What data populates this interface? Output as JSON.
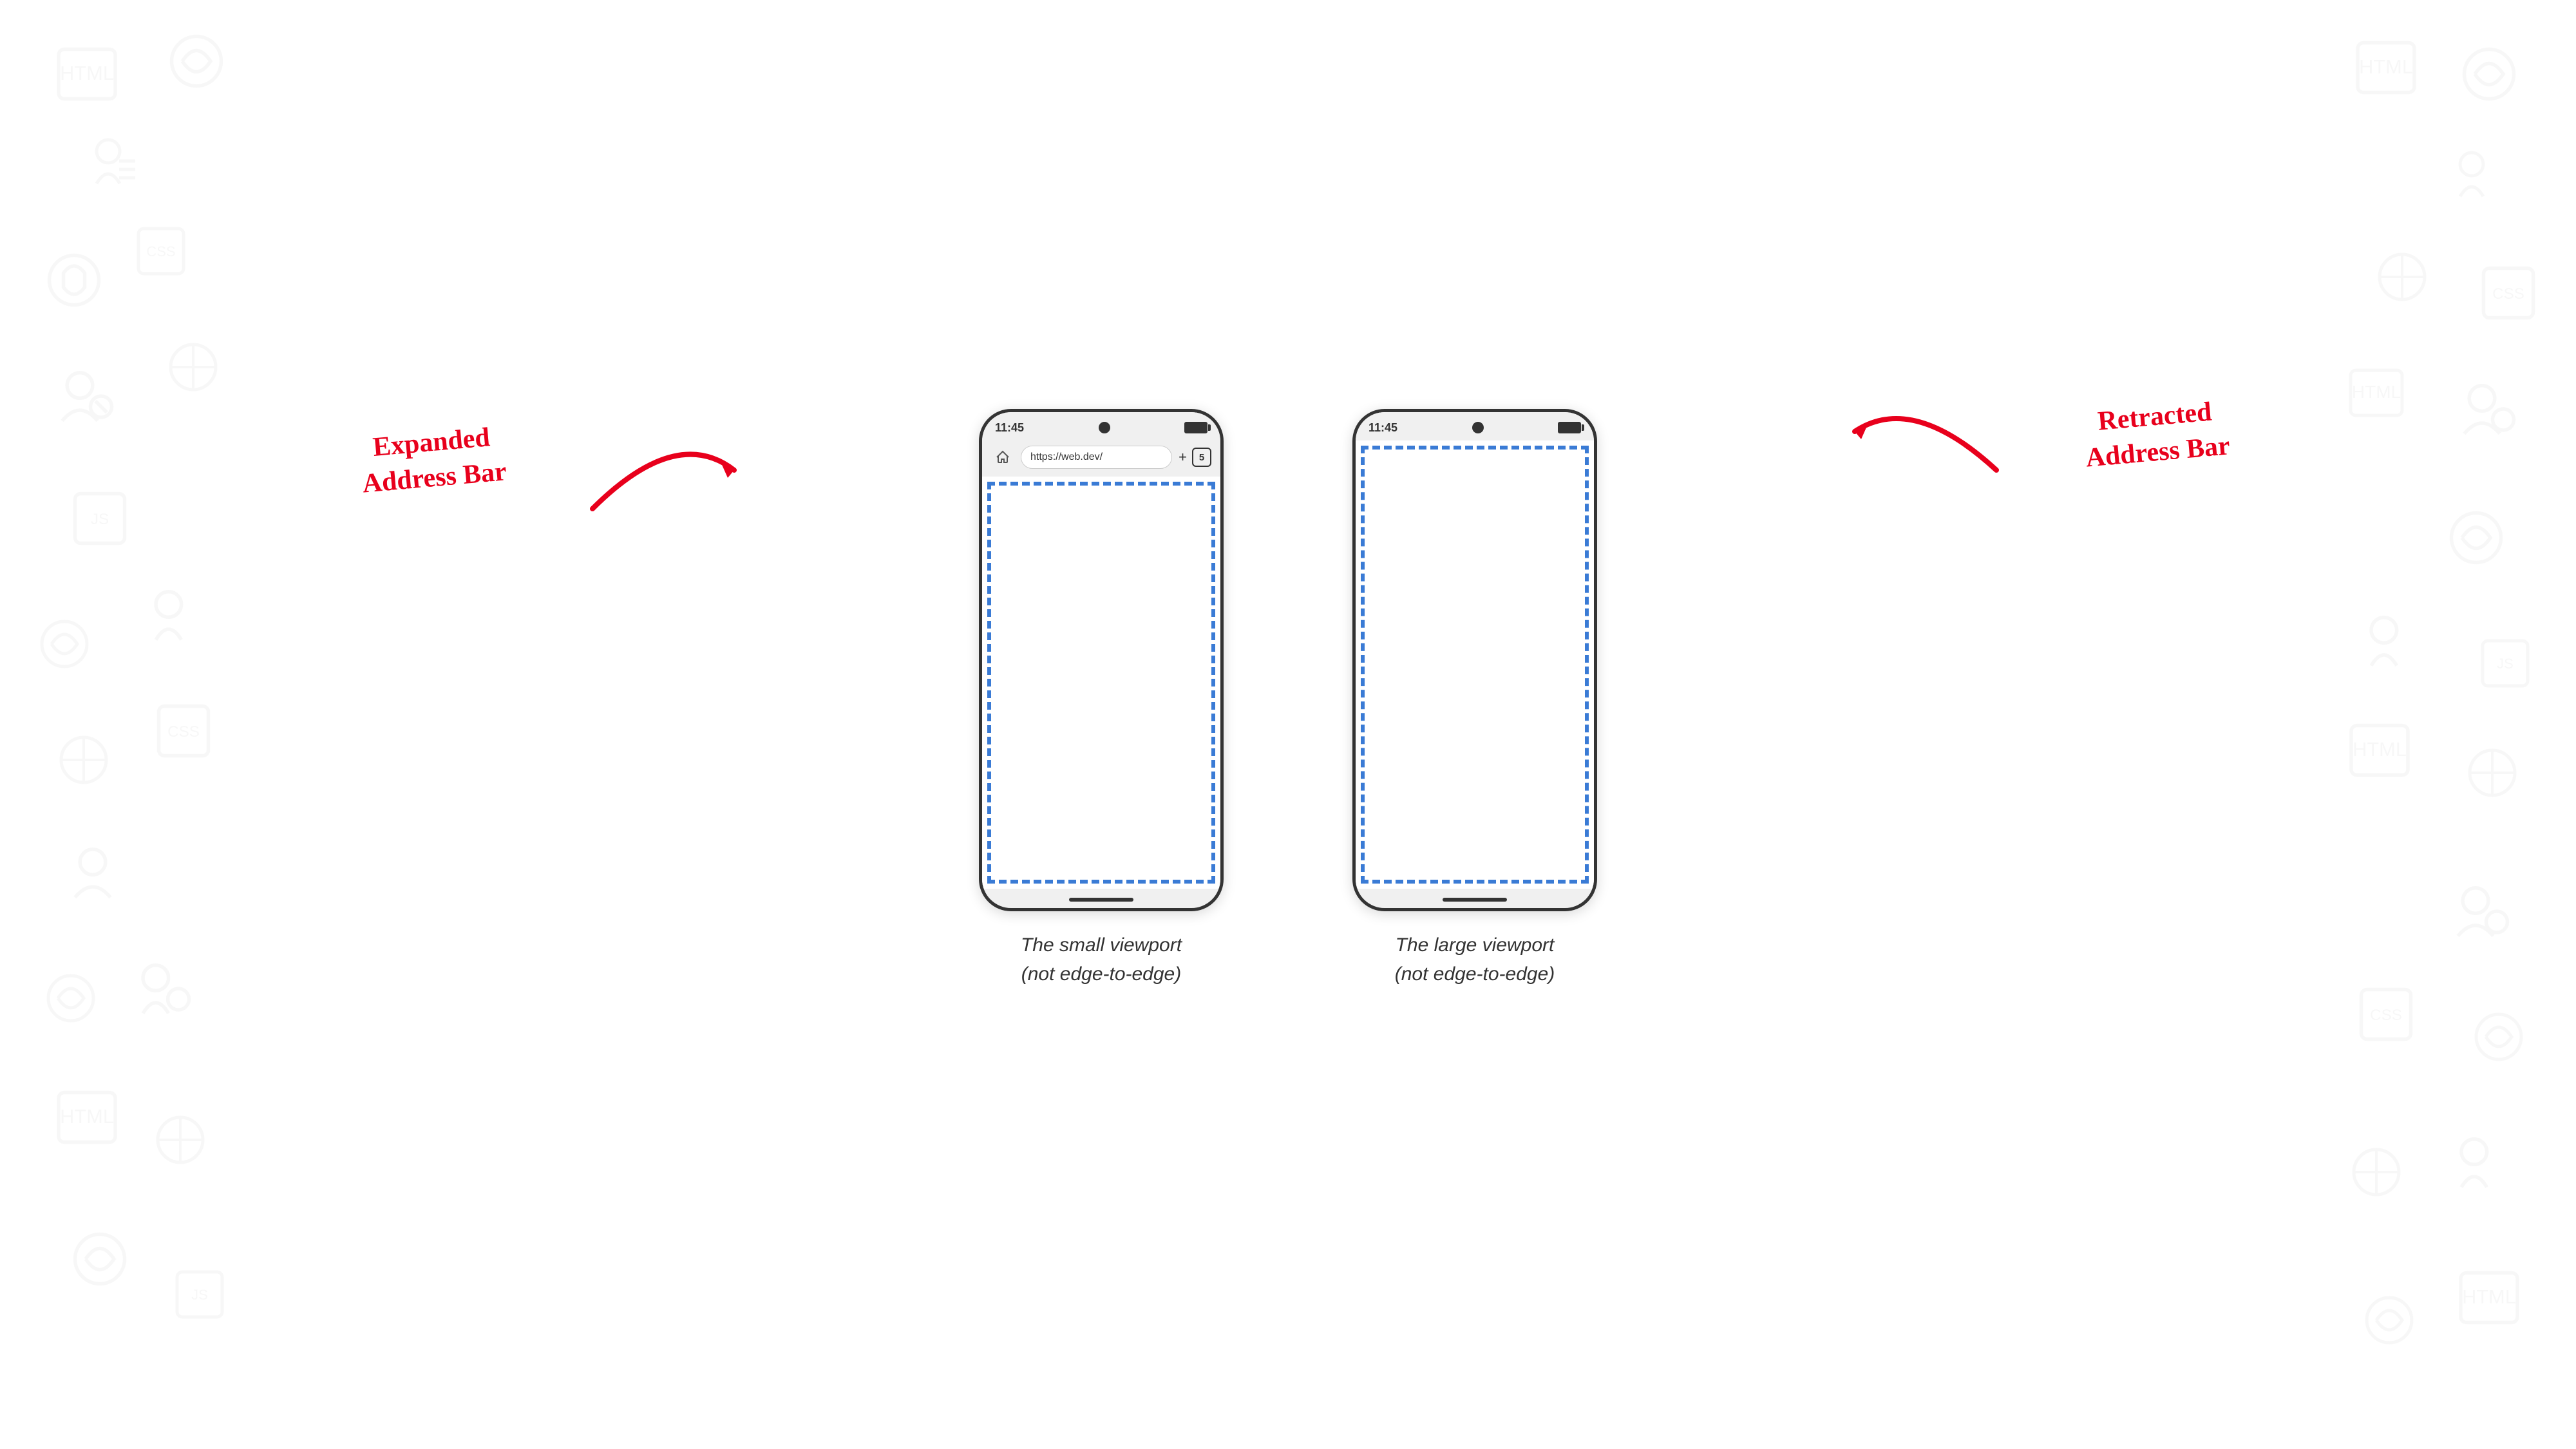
{
  "background": {
    "color": "#ffffff"
  },
  "phone_small": {
    "status_time": "11:45",
    "url": "https://web.dev/",
    "tab_count": "5",
    "label_line1": "The small viewport",
    "label_line2": "(not edge-to-edge)"
  },
  "phone_large": {
    "status_time": "11:45",
    "label_line1": "The large viewport",
    "label_line2": "(not edge-to-edge)"
  },
  "annotation_left": {
    "line1": "Expanded",
    "line2": "Address Bar"
  },
  "annotation_right": {
    "line1": "Retracted",
    "line2": "Address Bar"
  },
  "colors": {
    "accent_red": "#e8001c",
    "dashed_blue": "#3a7bd5",
    "phone_border": "#333333",
    "background": "#f0f0f0"
  }
}
